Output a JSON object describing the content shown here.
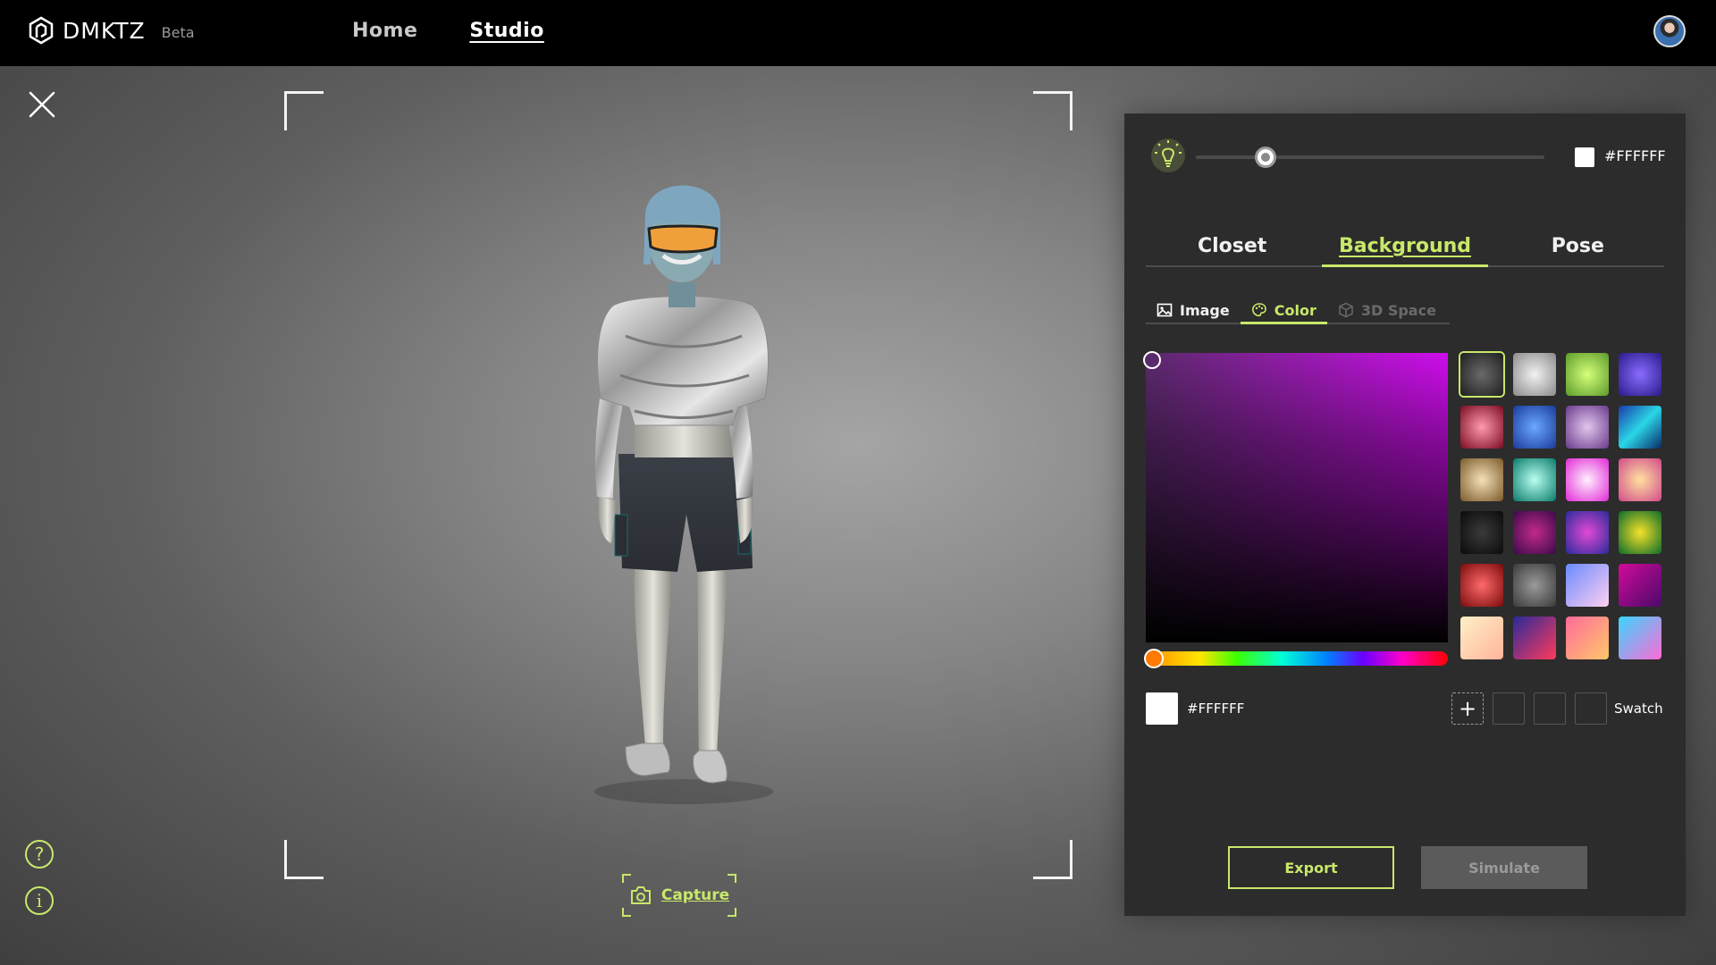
{
  "header": {
    "logo_text": "DMKTZ",
    "beta_label": "Beta",
    "nav": [
      {
        "label": "Home",
        "active": false
      },
      {
        "label": "Studio",
        "active": true
      }
    ]
  },
  "stage": {
    "capture_label": "Capture",
    "help_glyph": "?",
    "info_glyph": "i"
  },
  "panel": {
    "light": {
      "level": 0.2,
      "hex": "#FFFFFF"
    },
    "tabs": [
      {
        "label": "Closet",
        "active": false
      },
      {
        "label": "Background",
        "active": true
      },
      {
        "label": "Pose",
        "active": false
      }
    ],
    "subtabs": [
      {
        "label": "Image",
        "icon": "image-icon",
        "state": "default"
      },
      {
        "label": "Color",
        "icon": "palette-icon",
        "state": "active"
      },
      {
        "label": "3D Space",
        "icon": "cube-icon",
        "state": "disabled"
      }
    ],
    "current_hex": "#FFFFFF",
    "swatch_label": "Swatch",
    "add_glyph": "+",
    "export_label": "Export",
    "simulate_label": "Simulate"
  },
  "colors": {
    "accent": "#C8E86A",
    "panel_bg": "#2C2C2C",
    "header_bg": "#000000",
    "swatches": [
      "radial-gradient(circle, #6a6a6a 0%, #1e1e1e 100%)",
      "radial-gradient(circle, #f2f2f2 0%, #8a8a8a 100%)",
      "radial-gradient(circle, #d6ff7a 0%, #5b9a2a 100%)",
      "radial-gradient(circle, #8a6cff 0%, #2a1a8a 100%)",
      "radial-gradient(circle, #ff9aae 0%, #7a0a22 100%)",
      "radial-gradient(circle, #6aa8ff 0%, #1a3a9a 100%)",
      "radial-gradient(circle, #e2c6ee 0%, #6a3a8a 100%)",
      "linear-gradient(135deg, #1a3aaa 0%, #2ad6e6 50%, #0a2a6a 100%)",
      "radial-gradient(circle, #f6e0b8 0%, #7a5a2a 100%)",
      "radial-gradient(circle, #b8fff0 0%, #0a7a6a 100%)",
      "radial-gradient(circle, #fff0ff 0%, #e22ad6 100%)",
      "radial-gradient(circle, #ffe2a0 0%, #d24a8a 100%)",
      "radial-gradient(circle, #3a3a3a 0%, #0a0a0a 100%)",
      "radial-gradient(circle, #c22a8a 0%, #3a0a4a 100%)",
      "radial-gradient(circle, #e24ad6 0%, #2a2a9a 100%)",
      "radial-gradient(circle, #f6e22a 0%, #0a6a2a 100%)",
      "radial-gradient(circle, #ff6a6a 0%, #7a0a0a 100%)",
      "radial-gradient(circle, #9a9a9a 0%, #3a3a3a 100%)",
      "linear-gradient(135deg, #6a8aff 0%, #ffd0f0 100%)",
      "linear-gradient(135deg, #d20a9a 0%, #4a0a6a 100%)",
      "linear-gradient(135deg, #fff0c8 0%, #ffb49a 100%)",
      "linear-gradient(135deg, #2a2a9a 0%, #ff3a5a 100%)",
      "linear-gradient(135deg, #ff6a9a 0%, #ffc86a 100%)",
      "linear-gradient(135deg, #3ad6ff 0%, #ff6ad6 100%)"
    ],
    "saved_swatches": [
      "",
      "",
      ""
    ]
  }
}
